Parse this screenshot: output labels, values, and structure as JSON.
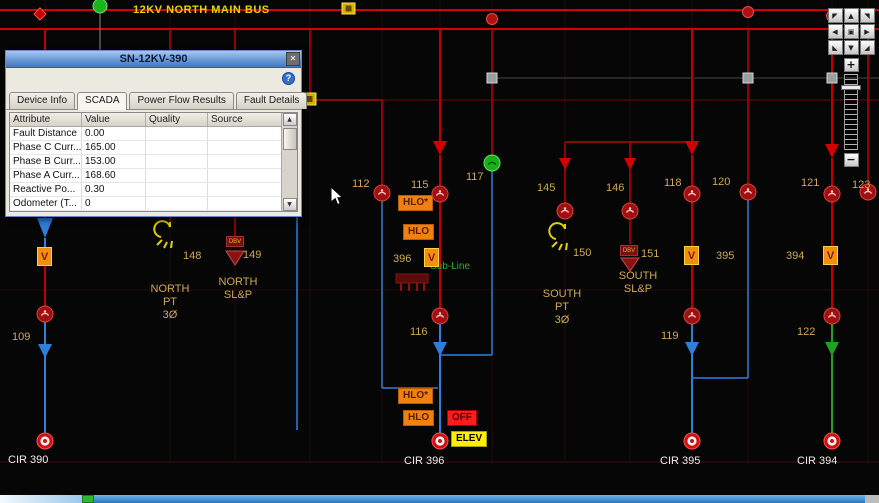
{
  "diagram": {
    "bus_title": "12KV NORTH MAIN BUS",
    "sub_line_label": "Sub-Line"
  },
  "nodes": {
    "n109": "109",
    "n112": "112",
    "n115": "115",
    "n116": "116",
    "n117": "117",
    "n118": "118",
    "n119": "119",
    "n120": "120",
    "n121": "121",
    "n122": "122",
    "n123": "123",
    "n145": "145",
    "n146": "146",
    "n148": "148",
    "n149": "149",
    "n150": "150",
    "n151": "151",
    "n394": "394",
    "n395": "395",
    "n396": "396"
  },
  "sections": {
    "north_pt": "NORTH\nPT\n3Ø",
    "north_slp": "NORTH\nSL&P",
    "south_pt": "SOUTH\nPT\n3Ø",
    "south_slp": "SOUTH\nSL&P"
  },
  "circuits": {
    "c390": "CIR 390",
    "c396": "CIR 396",
    "c395": "CIR 395",
    "c394": "CIR 394"
  },
  "badges": {
    "hlo_star": "HLO*",
    "hlo": "HLO",
    "off": "OFF",
    "elev": "ELEV"
  },
  "devices": {
    "regulator_letter": "V",
    "dbv_label": "DBV"
  },
  "dialog": {
    "title": "SN-12KV-390",
    "close_icon": "✕",
    "help_icon": "?",
    "scroll_up_icon": "▲",
    "scroll_down_icon": "▼",
    "tabs": [
      {
        "label": "Device Info"
      },
      {
        "label": "SCADA"
      },
      {
        "label": "Power Flow Results"
      },
      {
        "label": "Fault Details"
      }
    ],
    "columns": [
      "Attribute",
      "Value",
      "Quality",
      "Source"
    ],
    "rows": [
      {
        "attribute": "Fault Distance",
        "value": "0.00",
        "quality": "",
        "source": ""
      },
      {
        "attribute": "Phase C Curr...",
        "value": "165.00",
        "quality": "",
        "source": ""
      },
      {
        "attribute": "Phase B Curr...",
        "value": "153.00",
        "quality": "",
        "source": ""
      },
      {
        "attribute": "Phase A Curr...",
        "value": "168.60",
        "quality": "",
        "source": ""
      },
      {
        "attribute": "Reactive Po...",
        "value": "0.30",
        "quality": "",
        "source": ""
      },
      {
        "attribute": "Odometer (T...",
        "value": "0",
        "quality": "",
        "source": ""
      }
    ]
  },
  "zoom": {
    "pad": [
      "◤",
      "▲",
      "◥",
      "◀",
      "▣",
      "▶",
      "◣",
      "▼",
      "◢"
    ],
    "zoom_in": "+",
    "zoom_out": "−"
  },
  "colors": {
    "bus_red": "#d40000",
    "flow_blue": "#2e7fd8",
    "flow_green": "#1da31d",
    "label_tan": "#cfa94e",
    "badge_orange": "#f08010"
  }
}
